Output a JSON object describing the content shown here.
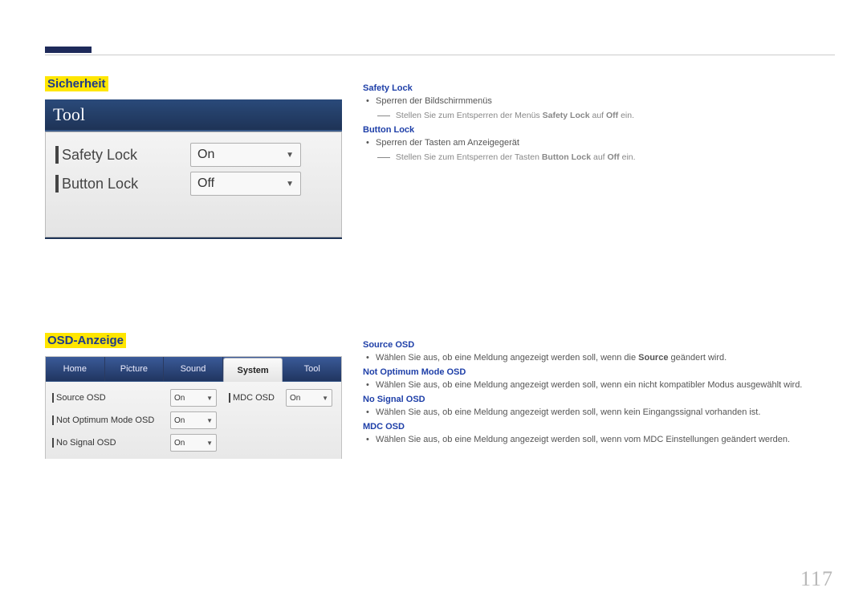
{
  "page_number": "117",
  "section1": {
    "heading": "Sicherheit",
    "screenshot": {
      "title": "Tool",
      "rows": [
        {
          "label": "Safety Lock",
          "value": "On"
        },
        {
          "label": "Button Lock",
          "value": "Off"
        }
      ]
    },
    "items": [
      {
        "head": "Safety Lock",
        "bullet": "Sperren der Bildschirmmenüs",
        "sub_pre": "Stellen Sie zum Entsperren der Menüs ",
        "sub_b1": "Safety Lock",
        "sub_mid": " auf ",
        "sub_b2": "Off",
        "sub_post": " ein."
      },
      {
        "head": "Button Lock",
        "bullet": "Sperren der Tasten am Anzeigegerät",
        "sub_pre": "Stellen Sie zum Entsperren der Tasten ",
        "sub_b1": "Button Lock",
        "sub_mid": " auf ",
        "sub_b2": "Off",
        "sub_post": " ein."
      }
    ]
  },
  "section2": {
    "heading": "OSD-Anzeige",
    "screenshot": {
      "tabs": [
        "Home",
        "Picture",
        "Sound",
        "System",
        "Tool"
      ],
      "active_tab_index": 3,
      "rows_left": [
        {
          "label": "Source OSD",
          "value": "On"
        },
        {
          "label": "Not Optimum Mode OSD",
          "value": "On"
        },
        {
          "label": "No Signal OSD",
          "value": "On"
        }
      ],
      "row_right": {
        "label": "MDC OSD",
        "value": "On"
      }
    },
    "items": [
      {
        "head": "Source OSD",
        "bullet_pre": "Wählen Sie aus, ob eine Meldung angezeigt werden soll, wenn die ",
        "bullet_b": "Source",
        "bullet_post": " geändert wird."
      },
      {
        "head": "Not Optimum Mode OSD",
        "bullet": "Wählen Sie aus, ob eine Meldung angezeigt werden soll, wenn ein nicht kompatibler Modus ausgewählt wird."
      },
      {
        "head": "No Signal OSD",
        "bullet": "Wählen Sie aus, ob eine Meldung angezeigt werden soll, wenn kein Eingangssignal vorhanden ist."
      },
      {
        "head": "MDC OSD",
        "bullet": "Wählen Sie aus, ob eine Meldung angezeigt werden soll, wenn vom MDC Einstellungen geändert werden."
      }
    ]
  }
}
